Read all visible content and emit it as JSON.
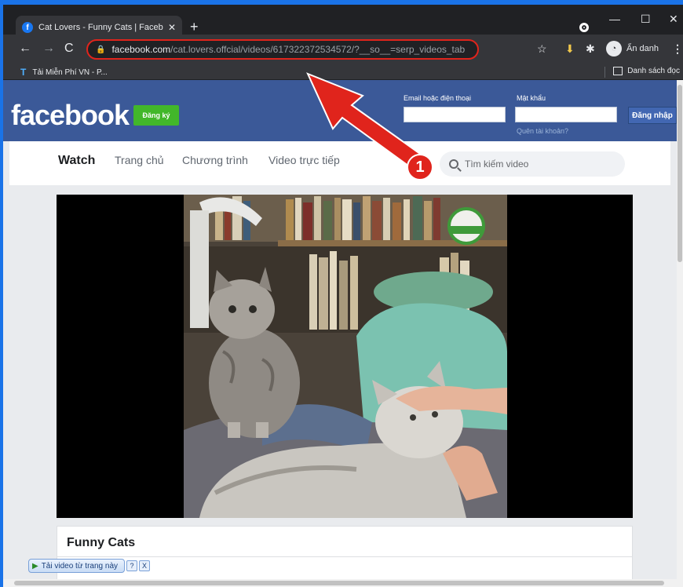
{
  "browser": {
    "tab_title": "Cat Lovers - Funny Cats | Facebo",
    "tab_close": "✕",
    "new_tab": "+",
    "url_host": "facebook.com",
    "url_path": "/cat.lovers.offcial/videos/617322372534572/?__so__=serp_videos_tab",
    "incognito_label": "Ẩn danh",
    "bookmark_label": "Tải Miễn Phí VN - P...",
    "reading_list": "Danh sách đọc"
  },
  "header": {
    "logo": "facebook",
    "signup": "Đăng ký",
    "email_label": "Email hoặc điện thoại",
    "password_label": "Mật khẩu",
    "login": "Đăng nhập",
    "forgot": "Quên tài khoản?"
  },
  "watch": {
    "active": "Watch",
    "tabs": [
      "Trang chủ",
      "Chương trình",
      "Video trực tiếp"
    ],
    "search_placeholder": "Tìm kiếm video"
  },
  "video": {
    "title": "Funny Cats"
  },
  "downloader": {
    "label": "Tải video từ trang này",
    "help": "?",
    "close": "X"
  },
  "annotation": {
    "step": "1",
    "color": "#e0241c"
  }
}
